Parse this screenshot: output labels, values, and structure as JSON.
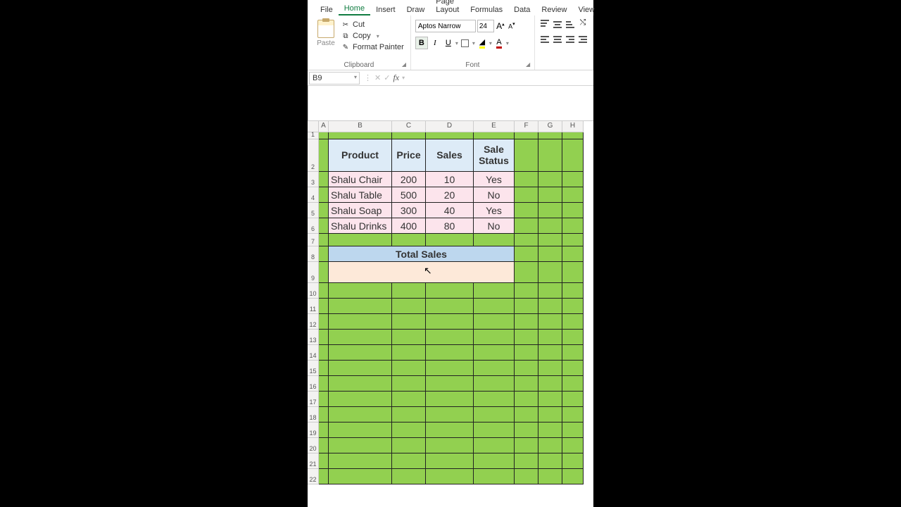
{
  "ribbon": {
    "tabs": [
      "File",
      "Home",
      "Insert",
      "Draw",
      "Page Layout",
      "Formulas",
      "Data",
      "Review",
      "View"
    ],
    "active_tab": "Home",
    "clipboard": {
      "label": "Clipboard",
      "paste": "Paste",
      "cut": "Cut",
      "copy": "Copy",
      "painter": "Format Painter"
    },
    "font": {
      "label": "Font",
      "name": "Aptos Narrow",
      "size": "24",
      "grow": "A",
      "shrink": "A",
      "bold": "B",
      "italic": "I",
      "underline": "U"
    }
  },
  "formula_bar": {
    "cell_ref": "B9",
    "formula": ""
  },
  "columns": [
    "A",
    "B",
    "C",
    "D",
    "E",
    "F",
    "G",
    "H"
  ],
  "col_widths": {
    "A": 14,
    "B": 90,
    "C": 48,
    "D": 68,
    "E": 58,
    "F": 34,
    "G": 34,
    "H": 30
  },
  "table": {
    "headers": {
      "product": "Product",
      "price": "Price",
      "sales": "Sales",
      "status": "Sale Status"
    },
    "rows": [
      {
        "product": "Shalu Chair",
        "price": "200",
        "sales": "10",
        "status": "Yes"
      },
      {
        "product": "Shalu Table",
        "price": "500",
        "sales": "20",
        "status": "No"
      },
      {
        "product": "Shalu Soap",
        "price": "300",
        "sales": "40",
        "status": "Yes"
      },
      {
        "product": "Shalu Drinks",
        "price": "400",
        "sales": "80",
        "status": "No"
      }
    ],
    "total_label": "Total Sales",
    "total_value": ""
  },
  "row_heights": {
    "1": 10,
    "2": 46,
    "data": 22,
    "7": 18,
    "8": 22,
    "9": 30,
    "rest": 22
  }
}
